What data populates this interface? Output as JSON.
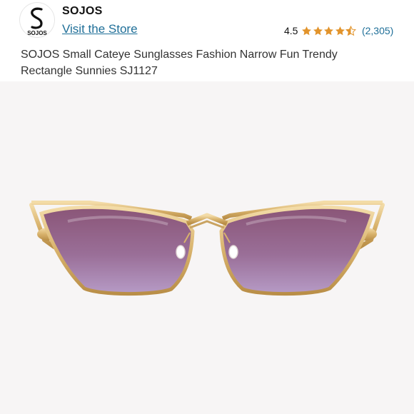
{
  "store": {
    "logo_text": "SOJOS",
    "name": "SOJOS",
    "visit_label": "Visit the Store"
  },
  "rating": {
    "value": "4.5",
    "stars": 4.5,
    "count": "(2,305)",
    "star_color": "#e2942c"
  },
  "product": {
    "title": "SOJOS Small Cateye Sunglasses Fashion Narrow Fun Trendy Rectangle Sunnies SJ1127"
  },
  "image": {
    "icon": "sunglasses-product-photo",
    "frame_color": "#d8b26c",
    "lens_color_top": "#8a5577",
    "lens_color_bottom": "#b69bc6",
    "background": "#f7f5f5"
  }
}
